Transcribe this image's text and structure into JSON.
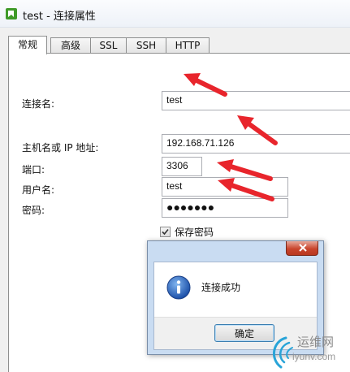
{
  "window": {
    "title": "test - 连接属性",
    "icon": "navicat-connection-icon"
  },
  "tabs": [
    {
      "label": "常规",
      "active": true
    },
    {
      "label": "高级",
      "active": false
    },
    {
      "label": "SSL",
      "active": false
    },
    {
      "label": "SSH",
      "active": false
    },
    {
      "label": "HTTP",
      "active": false
    }
  ],
  "form": {
    "connection_name": {
      "label": "连接名:",
      "value": "test"
    },
    "host": {
      "label": "主机名或 IP 地址:",
      "value": "192.168.71.126"
    },
    "port": {
      "label": "端口:",
      "value": "3306"
    },
    "username": {
      "label": "用户名:",
      "value": "test"
    },
    "password": {
      "label": "密码:",
      "value": "●●●●●●●"
    },
    "save_password": {
      "label": "保存密码",
      "checked": true
    }
  },
  "dialog": {
    "message": "连接成功",
    "ok_label": "确定",
    "icon": "info-icon"
  },
  "watermark": {
    "brand": "运维网",
    "site": "iyunv.com"
  },
  "colors": {
    "arrow": "#e8252c",
    "title_bar": "#eef2f8",
    "dialog_frame": "#c9dcf2",
    "close_button": "#c9452d"
  }
}
